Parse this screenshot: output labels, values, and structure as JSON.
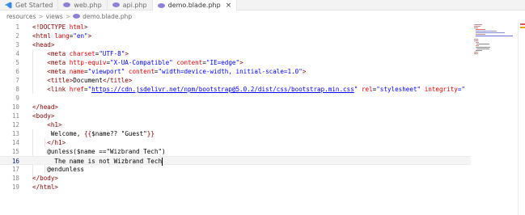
{
  "tabs": [
    {
      "label": "Get Started",
      "icon": "vscode-logo-icon",
      "active": false
    },
    {
      "label": "web.php",
      "icon": "php-file-icon",
      "active": false
    },
    {
      "label": "api.php",
      "icon": "php-file-icon",
      "active": false
    },
    {
      "label": "demo.blade.php",
      "icon": "php-file-icon",
      "active": true,
      "close": "×"
    }
  ],
  "breadcrumb": [
    "resources",
    "views",
    "demo.blade.php"
  ],
  "breadcrumb_sep": ">",
  "lines": [
    {
      "n": "1",
      "tokens": [
        {
          "t": "<!DOCTYPE ",
          "c": "tg"
        },
        {
          "t": "html",
          "c": "at"
        },
        {
          "t": ">",
          "c": "tg"
        }
      ]
    },
    {
      "n": "2",
      "tokens": [
        {
          "t": "<html ",
          "c": "tg"
        },
        {
          "t": "lang",
          "c": "at"
        },
        {
          "t": "=",
          "c": "pl"
        },
        {
          "t": "\"en\"",
          "c": "st"
        },
        {
          "t": ">",
          "c": "tg"
        }
      ]
    },
    {
      "n": "3",
      "tokens": [
        {
          "t": "<head>",
          "c": "tg"
        }
      ]
    },
    {
      "n": "4",
      "tokens": [
        {
          "t": "    <meta ",
          "c": "tg"
        },
        {
          "t": "charset",
          "c": "at"
        },
        {
          "t": "=",
          "c": "pl"
        },
        {
          "t": "\"UTF-8\"",
          "c": "st"
        },
        {
          "t": ">",
          "c": "tg"
        }
      ]
    },
    {
      "n": "5",
      "tokens": [
        {
          "t": "    <meta ",
          "c": "tg"
        },
        {
          "t": "http-equiv",
          "c": "at"
        },
        {
          "t": "=",
          "c": "pl"
        },
        {
          "t": "\"X-UA-Compatible\"",
          "c": "st"
        },
        {
          "t": " ",
          "c": "pl"
        },
        {
          "t": "content",
          "c": "at"
        },
        {
          "t": "=",
          "c": "pl"
        },
        {
          "t": "\"IE=edge\"",
          "c": "st"
        },
        {
          "t": ">",
          "c": "tg"
        }
      ]
    },
    {
      "n": "6",
      "tokens": [
        {
          "t": "    <meta ",
          "c": "tg"
        },
        {
          "t": "name",
          "c": "at"
        },
        {
          "t": "=",
          "c": "pl"
        },
        {
          "t": "\"viewport\"",
          "c": "st"
        },
        {
          "t": " ",
          "c": "pl"
        },
        {
          "t": "content",
          "c": "at"
        },
        {
          "t": "=",
          "c": "pl"
        },
        {
          "t": "\"width=device-width, initial-scale=1.0\"",
          "c": "st"
        },
        {
          "t": ">",
          "c": "tg"
        }
      ]
    },
    {
      "n": "7",
      "tokens": [
        {
          "t": "    <title>",
          "c": "tg"
        },
        {
          "t": "Document",
          "c": "pl"
        },
        {
          "t": "</title>",
          "c": "tg"
        }
      ]
    },
    {
      "n": "8",
      "tokens": [
        {
          "t": "    <link ",
          "c": "tg"
        },
        {
          "t": "href",
          "c": "at"
        },
        {
          "t": "=",
          "c": "pl"
        },
        {
          "t": "\"",
          "c": "st"
        },
        {
          "t": "https://cdn.jsdelivr.net/npm/bootstrap@5.0.2/dist/css/bootstrap.min.css",
          "c": "lnk"
        },
        {
          "t": "\"",
          "c": "st"
        },
        {
          "t": " ",
          "c": "pl"
        },
        {
          "t": "rel",
          "c": "at"
        },
        {
          "t": "=",
          "c": "pl"
        },
        {
          "t": "\"stylesheet\"",
          "c": "st"
        },
        {
          "t": " ",
          "c": "pl"
        },
        {
          "t": "integrity",
          "c": "at"
        },
        {
          "t": "=\"",
          "c": "st"
        }
      ]
    },
    {
      "n": "9",
      "tokens": []
    },
    {
      "n": "10",
      "tokens": [
        {
          "t": "</head>",
          "c": "tg"
        }
      ]
    },
    {
      "n": "11",
      "tokens": [
        {
          "t": "<body>",
          "c": "tg"
        }
      ]
    },
    {
      "n": "12",
      "tokens": [
        {
          "t": "    <h1>",
          "c": "tg"
        }
      ]
    },
    {
      "n": "13",
      "tokens": [
        {
          "t": "     Welcome, ",
          "c": "pl"
        },
        {
          "t": "{{",
          "c": "bd"
        },
        {
          "t": "$name?? ",
          "c": "pl"
        },
        {
          "t": "\"Guest\"",
          "c": "pl"
        },
        {
          "t": "}}",
          "c": "bd"
        }
      ]
    },
    {
      "n": "14",
      "tokens": [
        {
          "t": "    </h1>",
          "c": "tg"
        }
      ]
    },
    {
      "n": "15",
      "tokens": [
        {
          "t": "    @unless($name ==",
          "c": "pl"
        },
        {
          "t": "\"Wizbrand Tech\"",
          "c": "pl"
        },
        {
          "t": ")",
          "c": "pl"
        }
      ]
    },
    {
      "n": "16",
      "tokens": [
        {
          "t": "      The name is not Wizbrand Tech",
          "c": "pl"
        }
      ],
      "current": true
    },
    {
      "n": "17",
      "tokens": [
        {
          "t": "    @endunless",
          "c": "pl"
        }
      ]
    },
    {
      "n": "18",
      "tokens": [
        {
          "t": "</body>",
          "c": "tg"
        }
      ]
    },
    {
      "n": "19",
      "tokens": [
        {
          "t": "</html>",
          "c": "tg"
        }
      ]
    }
  ],
  "colors": {
    "tag": "#800000",
    "attribute": "#e50000",
    "string": "#0000ff",
    "link": "#0000ff",
    "text": "#000000",
    "line_number": "#8a8a8a",
    "current_line_bg": "#f4f4f4"
  }
}
